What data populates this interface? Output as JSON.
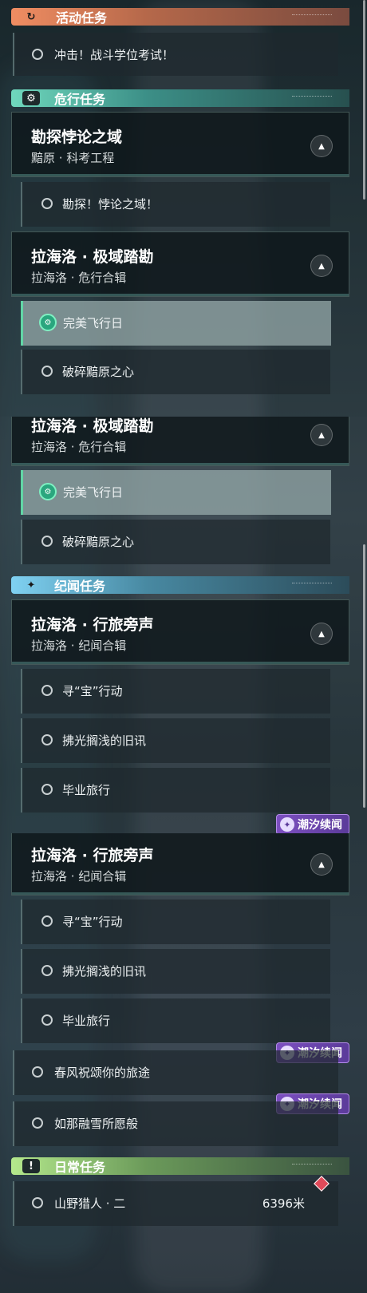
{
  "panel1": {
    "activity": {
      "header": "活动任务",
      "icon": "refresh-icon",
      "task": "冲击！战斗学位考试！"
    },
    "danger": {
      "header": "危行任务",
      "icon": "gear-badge-icon",
      "group1": {
        "title": "勘探悖论之域",
        "subtitle": "黯原 · 科考工程",
        "task": "勘探！悖论之域！"
      },
      "group2": {
        "title": "拉海洛 · 极域踏勘",
        "subtitle": "拉海洛 · 危行合辑",
        "tasks": [
          "完美飞行日",
          "破碎黯原之心"
        ]
      }
    }
  },
  "panel2": {
    "danger_group": {
      "title": "拉海洛 · 极域踏勘",
      "subtitle": "拉海洛 · 危行合辑",
      "tasks": [
        "完美飞行日",
        "破碎黯原之心"
      ]
    },
    "story": {
      "header": "纪闻任务",
      "icon": "sparkle-icon",
      "group": {
        "title": "拉海洛 · 行旅旁声",
        "subtitle": "拉海洛 · 纪闻合辑",
        "tasks": [
          "寻“宝”行动",
          "拂光搁浅的旧讯",
          "毕业旅行"
        ]
      },
      "tide_badge": "潮汐续闻"
    }
  },
  "panel3": {
    "group": {
      "title": "拉海洛 · 行旅旁声",
      "subtitle": "拉海洛 · 纪闻合辑",
      "tasks": [
        "寻“宝”行动",
        "拂光搁浅的旧讯",
        "毕业旅行"
      ]
    },
    "tide_tasks": [
      {
        "label": "春风祝颂你的旅途",
        "badge": "潮汐续闻"
      },
      {
        "label": "如那融雪所愿般",
        "badge": "潮汐续闻"
      }
    ],
    "daily": {
      "header": "日常任务",
      "icon": "alert-icon",
      "task": "山野猎人 · 二",
      "distance": "6396米"
    }
  },
  "colors": {
    "active_accent": "#62d6a6",
    "tide": "#7c4fc0",
    "danger_header": "#6fd8bd",
    "activity_header": "#f08d62",
    "story_header": "#7fd1f2",
    "daily_header": "#b4e88c"
  }
}
